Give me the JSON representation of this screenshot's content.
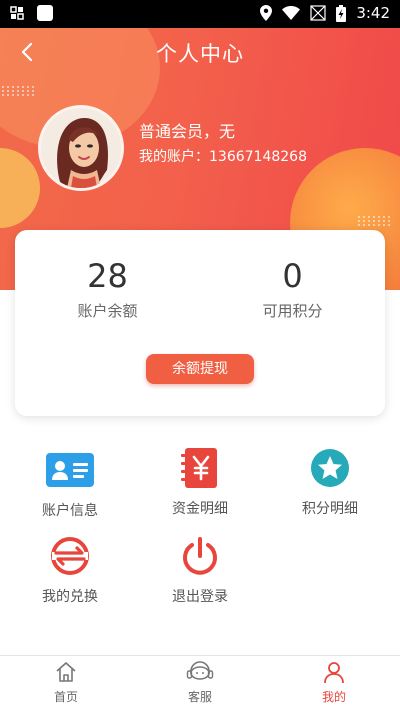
{
  "status_bar": {
    "time": "3:42"
  },
  "header": {
    "title": "个人中心",
    "member_text": "普通会员，无",
    "account_label": "我的账户：",
    "account_number": "13667148268"
  },
  "stats": [
    {
      "value": "28",
      "label": "账户余额"
    },
    {
      "value": "0",
      "label": "可用积分"
    }
  ],
  "withdraw_button": "余额提现",
  "grid": [
    {
      "label": "账户信息",
      "icon": "id-card-icon"
    },
    {
      "label": "资金明细",
      "icon": "yuan-notebook-icon"
    },
    {
      "label": "积分明细",
      "icon": "star-badge-icon"
    },
    {
      "label": "我的兑换",
      "icon": "exchange-icon"
    },
    {
      "label": "退出登录",
      "icon": "power-icon"
    }
  ],
  "tabs": [
    {
      "label": "首页",
      "icon": "home-icon"
    },
    {
      "label": "客服",
      "icon": "headset-icon"
    },
    {
      "label": "我的",
      "icon": "user-icon",
      "active": true
    }
  ],
  "colors": {
    "accent": "#f15f43",
    "header_gradient_start": "#f26a4a",
    "header_gradient_end": "#f0484a",
    "active_tab": "#e8453c",
    "icon_blue": "#2d9ee8",
    "icon_teal": "#26a9b8"
  }
}
